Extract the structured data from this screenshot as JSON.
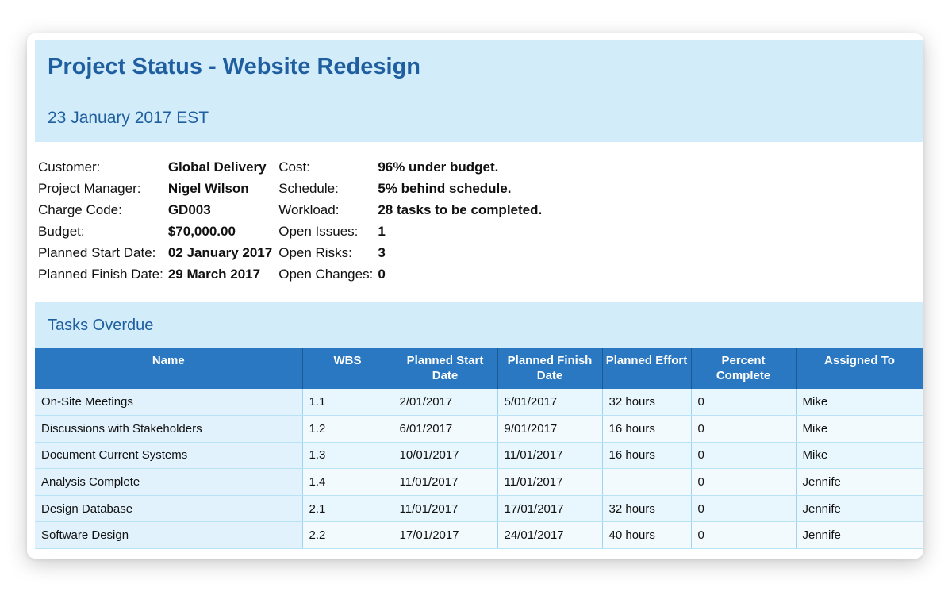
{
  "report": {
    "title": "Project Status - Website Redesign",
    "date": "23 January 2017 EST"
  },
  "summary": [
    {
      "label": "Customer:",
      "value": "Global Delivery",
      "label2": "Cost:",
      "value2": "96% under budget."
    },
    {
      "label": "Project Manager:",
      "value": "Nigel Wilson",
      "label2": "Schedule:",
      "value2": "5% behind schedule."
    },
    {
      "label": "Charge Code:",
      "value": "GD003",
      "label2": "Workload:",
      "value2": "28 tasks to be completed."
    },
    {
      "label": "Budget:",
      "value": "$70,000.00",
      "label2": "Open Issues:",
      "value2": "1"
    },
    {
      "label": "Planned Start Date:",
      "value": "02 January 2017",
      "label2": "Open Risks:",
      "value2": "3"
    },
    {
      "label": "Planned Finish Date:",
      "value": "29 March 2017",
      "label2": "Open Changes:",
      "value2": "0"
    }
  ],
  "tasks_section": {
    "title": "Tasks Overdue",
    "columns": [
      "Name",
      "WBS",
      "Planned Start Date",
      "Planned Finish Date",
      "Planned Effort",
      "Percent Complete",
      "Assigned To"
    ],
    "rows": [
      [
        "On-Site Meetings",
        "1.1",
        "2/01/2017",
        "5/01/2017",
        "32 hours",
        "0",
        "Mike"
      ],
      [
        "Discussions with Stakeholders",
        "1.2",
        "6/01/2017",
        "9/01/2017",
        "16 hours",
        "0",
        "Mike"
      ],
      [
        "Document Current Systems",
        "1.3",
        "10/01/2017",
        "11/01/2017",
        "16 hours",
        "0",
        "Mike"
      ],
      [
        "Analysis Complete",
        "1.4",
        "11/01/2017",
        "11/01/2017",
        "",
        "0",
        "Jennife"
      ],
      [
        "Design Database",
        "2.1",
        "11/01/2017",
        "17/01/2017",
        "32 hours",
        "0",
        "Jennife"
      ],
      [
        "Software Design",
        "2.2",
        "17/01/2017",
        "24/01/2017",
        "40 hours",
        "0",
        "Jennife"
      ]
    ]
  },
  "colors": {
    "title_blue": "#1f5fa0",
    "header_band": "#d3ecfa",
    "table_header": "#2a78c2"
  }
}
